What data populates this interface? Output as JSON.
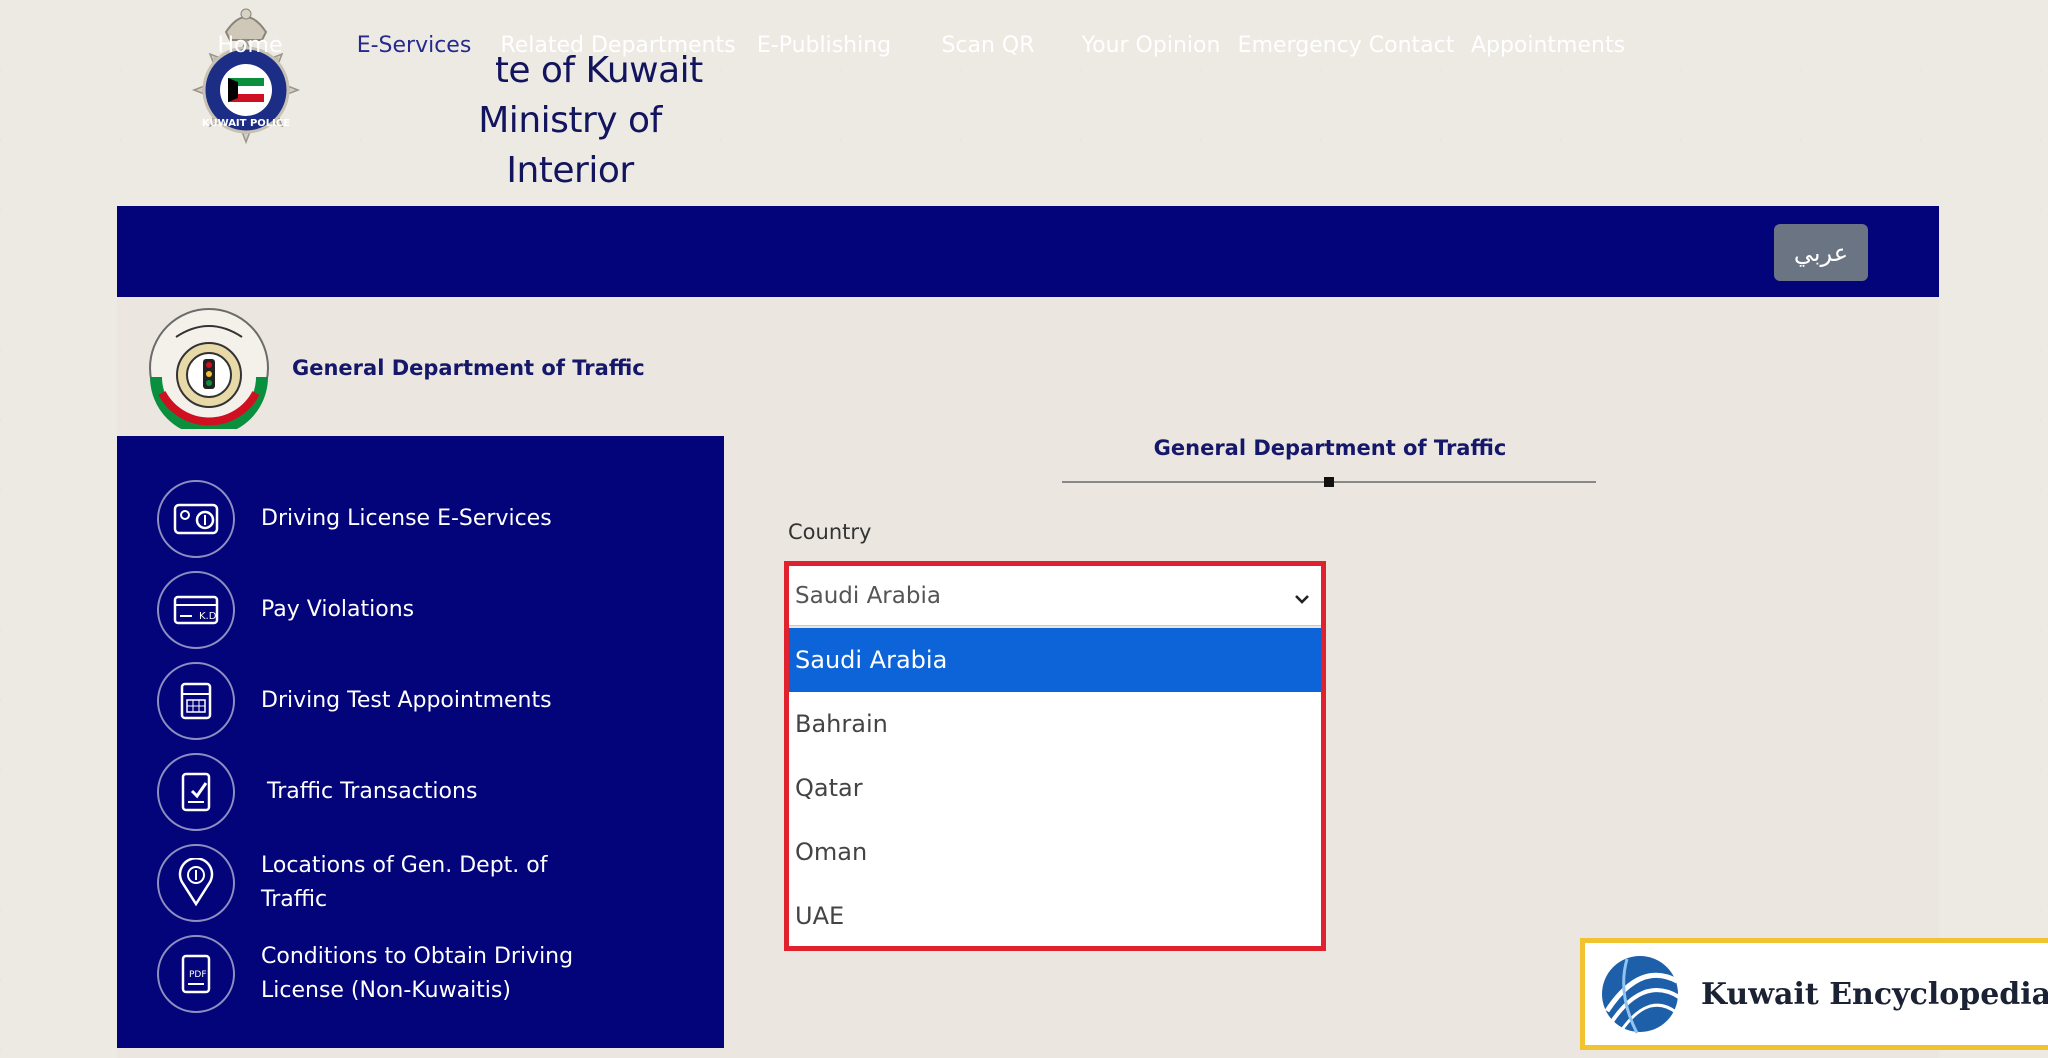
{
  "header": {
    "title_line1": "State of Kuwait",
    "title_line2": "Ministry of Interior",
    "logo_icon": "kuwait-police-emblem"
  },
  "nav": {
    "items": [
      {
        "label": "Home",
        "active": false
      },
      {
        "label": "E-Services",
        "active": true
      },
      {
        "label": "Related Departments",
        "active": false
      },
      {
        "label": "E-Publishing",
        "active": false
      },
      {
        "label": "Scan QR",
        "active": false
      },
      {
        "label": "Your Opinion",
        "active": false
      },
      {
        "label": "Emergency Contact",
        "active": false
      },
      {
        "label": "Appointments",
        "active": false
      }
    ],
    "language_button": "عربي"
  },
  "department": {
    "title": "General Department of Traffic",
    "logo_icon": "traffic-department-emblem"
  },
  "sidebar": {
    "items": [
      {
        "label": "Driving License E-Services",
        "icon": "license-card-icon"
      },
      {
        "label": "Pay Violations",
        "icon": "payment-card-icon"
      },
      {
        "label": "Driving Test Appointments",
        "icon": "calendar-icon"
      },
      {
        "label": "Traffic Transactions",
        "icon": "checklist-icon"
      },
      {
        "label": "Locations of Gen. Dept. of Traffic",
        "icon": "location-pin-icon"
      },
      {
        "label": "Conditions to Obtain Driving License (Non-Kuwaitis)",
        "icon": "pdf-document-icon"
      }
    ]
  },
  "main": {
    "heading": "General Department of Traffic",
    "country_label": "Country",
    "country_select": {
      "selected": "Saudi Arabia",
      "options": [
        "Saudi Arabia",
        "Bahrain",
        "Qatar",
        "Oman",
        "UAE"
      ]
    }
  },
  "watermark": {
    "text": "Kuwait Encyclopedia",
    "icon": "globe-icon"
  },
  "colors": {
    "nav_bg": "#03037a",
    "highlight_border": "#e0212e",
    "selected_option": "#0c64d8",
    "badge_border": "#f2c330"
  }
}
